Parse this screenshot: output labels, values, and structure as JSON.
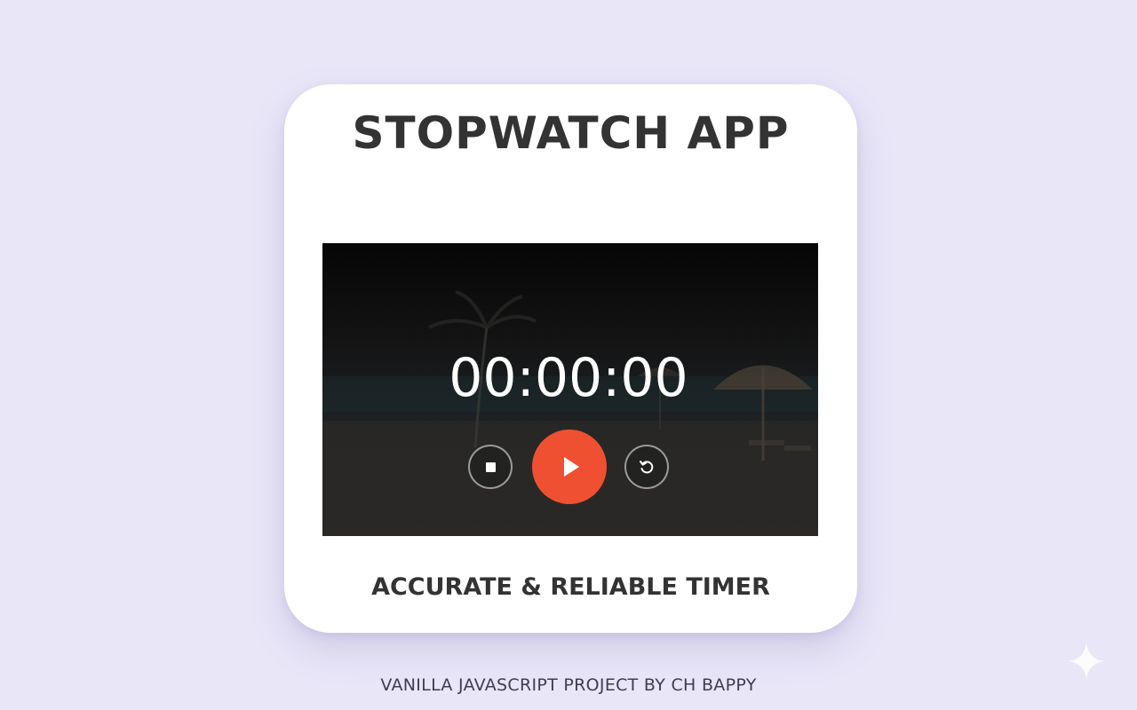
{
  "app": {
    "title": "STOPWATCH APP",
    "tagline": "ACCURATE & RELIABLE TIMER",
    "footer": "VANILLA JAVASCRIPT PROJECT BY CH BAPPY"
  },
  "timer": {
    "display": "00:00:00"
  },
  "controls": {
    "stop_icon": "stop-icon",
    "play_icon": "play-icon",
    "reset_icon": "reset-icon"
  },
  "colors": {
    "background": "#e9e6f8",
    "card": "#ffffff",
    "accent": "#f05032",
    "title_text": "#333333"
  }
}
